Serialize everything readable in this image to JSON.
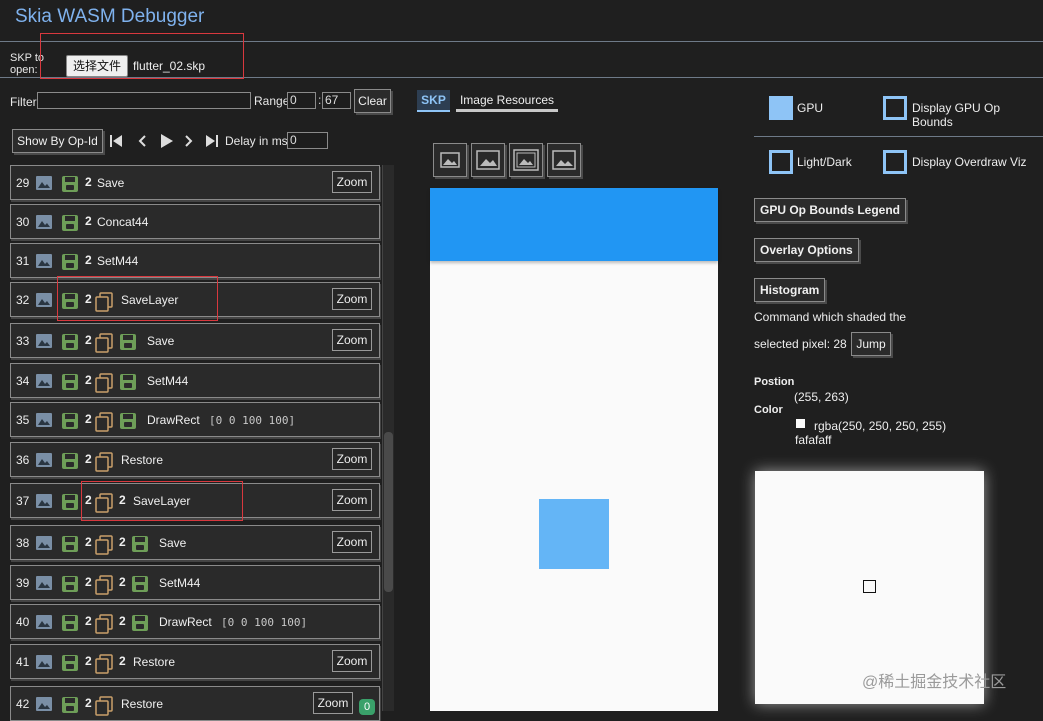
{
  "header": {
    "title": "Skia WASM Debugger",
    "skp_label": "SKP to open:",
    "file_button": "选择文件",
    "file_name": "flutter_02.skp"
  },
  "controls": {
    "filter_label": "Filter",
    "filter_value": "",
    "range_label": "Range",
    "range_start": "0",
    "range_end": "67",
    "clear_label": "Clear",
    "show_by_label": "Show By Op-Id",
    "delay_label": "Delay in ms",
    "delay_value": "0"
  },
  "tabs": {
    "skp": "SKP",
    "image_resources": "Image Resources"
  },
  "commands": [
    {
      "index": "29",
      "save_indicator": true,
      "count": "2",
      "name": "Save",
      "zoom": "Zoom"
    },
    {
      "index": "30",
      "save_indicator": true,
      "count": "2",
      "name": "Concat44"
    },
    {
      "index": "31",
      "save_indicator": true,
      "count": "2",
      "name": "SetM44"
    },
    {
      "index": "32",
      "save_indicator": true,
      "count": "2",
      "layer_indicator": true,
      "name": "SaveLayer",
      "zoom": "Zoom"
    },
    {
      "index": "33",
      "save_indicator": true,
      "count": "2",
      "layer_indicator": true,
      "save2_indicator": true,
      "name": "Save",
      "zoom": "Zoom"
    },
    {
      "index": "34",
      "save_indicator": true,
      "count": "2",
      "layer_indicator": true,
      "save2_indicator": true,
      "name": "SetM44"
    },
    {
      "index": "35",
      "save_indicator": true,
      "count": "2",
      "layer_indicator": true,
      "save2_indicator": true,
      "name": "DrawRect",
      "args": "[0 0 100 100]"
    },
    {
      "index": "36",
      "save_indicator": true,
      "count": "2",
      "layer_indicator": true,
      "name": "Restore",
      "zoom": "Zoom"
    },
    {
      "index": "37",
      "save_indicator": true,
      "count": "2",
      "layer_indicator": true,
      "count2": "2",
      "name": "SaveLayer",
      "zoom": "Zoom"
    },
    {
      "index": "38",
      "save_indicator": true,
      "count": "2",
      "layer_indicator": true,
      "count2": "2",
      "save2_indicator": true,
      "name": "Save",
      "zoom": "Zoom"
    },
    {
      "index": "39",
      "save_indicator": true,
      "count": "2",
      "layer_indicator": true,
      "count2": "2",
      "save2_indicator": true,
      "name": "SetM44"
    },
    {
      "index": "40",
      "save_indicator": true,
      "count": "2",
      "layer_indicator": true,
      "count2": "2",
      "save2_indicator": true,
      "name": "DrawRect",
      "args": "[0 0 100 100]"
    },
    {
      "index": "41",
      "save_indicator": true,
      "count": "2",
      "layer_indicator": true,
      "count2": "2",
      "name": "Restore",
      "zoom": "Zoom"
    },
    {
      "index": "42",
      "save_indicator": true,
      "count": "2",
      "layer_indicator": true,
      "name": "Restore",
      "zoom": "Zoom",
      "badge": "0"
    }
  ],
  "right_panel": {
    "gpu": {
      "label": "GPU",
      "checked": true
    },
    "gpu_bounds": {
      "label": "Display GPU Op Bounds",
      "checked": false
    },
    "light_dark": {
      "label": "Light/Dark",
      "checked": false
    },
    "overdraw": {
      "label": "Display Overdraw Viz",
      "checked": false
    },
    "legend_button": "GPU Op Bounds Legend",
    "overlay_button": "Overlay Options",
    "histogram_button": "Histogram",
    "shaded_text_1": "Command which shaded the",
    "shaded_text_2": "selected pixel: 28",
    "jump_button": "Jump",
    "position_label": "Postion",
    "position_value": "(255, 263)",
    "color_label": "Color",
    "color_rgba": "rgba(250, 250, 250, 255)",
    "color_hex": "fafafaff"
  },
  "watermark": "@稀土掘金技术社区",
  "colors": {
    "accent": "#8ec4f6",
    "canvas_bar": "#2196f3",
    "canvas_square": "#64b5f6",
    "canvas_bg": "#fafafa",
    "highlight": "#d8383e"
  }
}
